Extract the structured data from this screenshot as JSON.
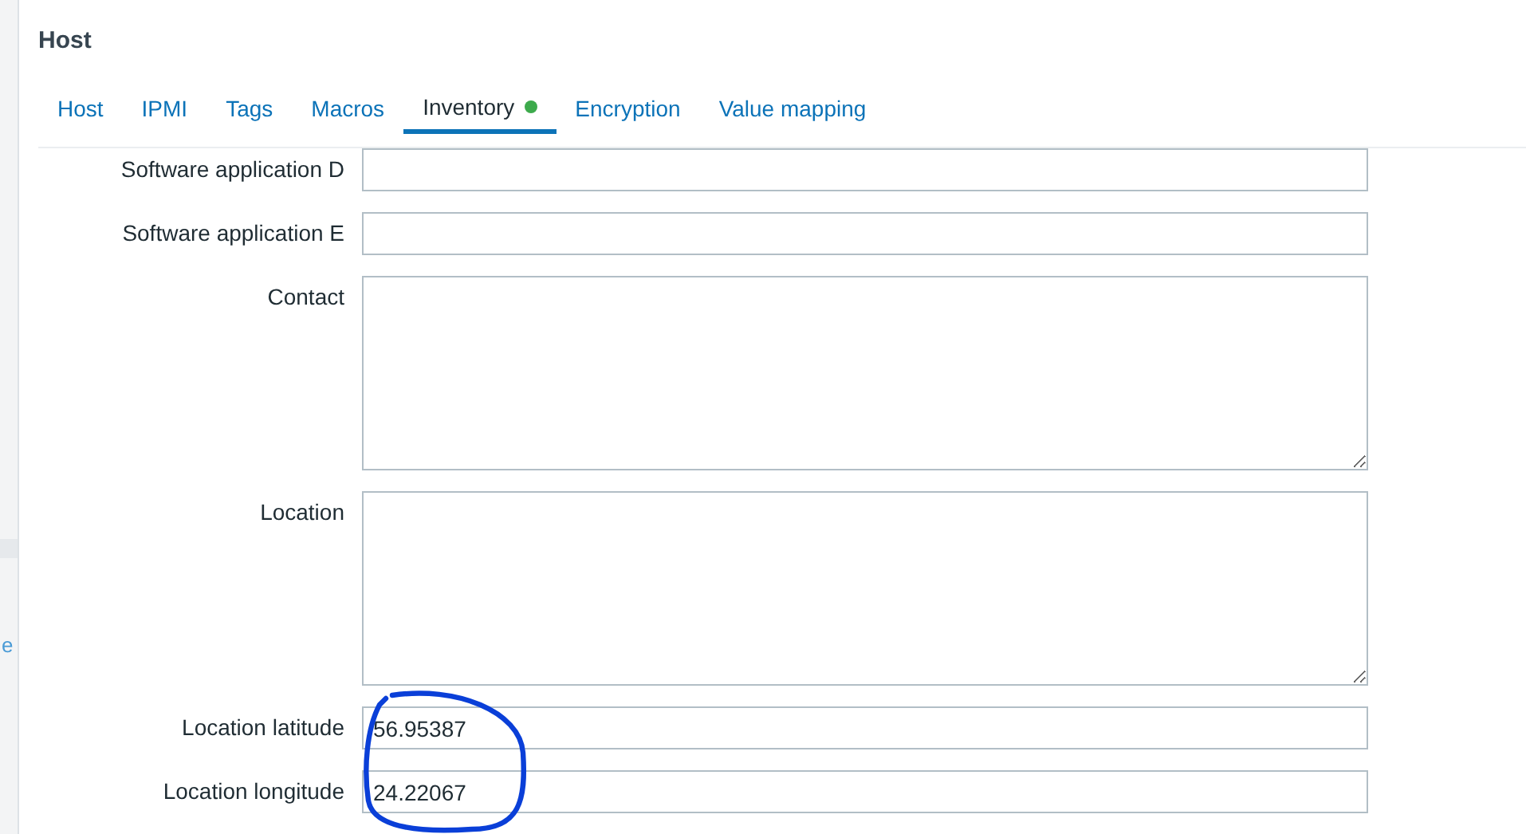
{
  "background": {
    "link_fragment": "e"
  },
  "dialog": {
    "title": "Host"
  },
  "tabs": [
    {
      "label": "Host",
      "selected": false,
      "indicator": false
    },
    {
      "label": "IPMI",
      "selected": false,
      "indicator": false
    },
    {
      "label": "Tags",
      "selected": false,
      "indicator": false
    },
    {
      "label": "Macros",
      "selected": false,
      "indicator": false
    },
    {
      "label": "Inventory",
      "selected": true,
      "indicator": true
    },
    {
      "label": "Encryption",
      "selected": false,
      "indicator": false
    },
    {
      "label": "Value mapping",
      "selected": false,
      "indicator": false
    }
  ],
  "fields": [
    {
      "label": "Software application D",
      "kind": "input"
    },
    {
      "label": "Software application E",
      "kind": "input"
    },
    {
      "label": "Contact",
      "kind": "textarea"
    },
    {
      "label": "Location",
      "kind": "textarea"
    },
    {
      "label": "Location latitude",
      "kind": "input",
      "value": "56.95387"
    },
    {
      "label": "Location longitude",
      "kind": "input",
      "value": "24.22067"
    }
  ]
}
